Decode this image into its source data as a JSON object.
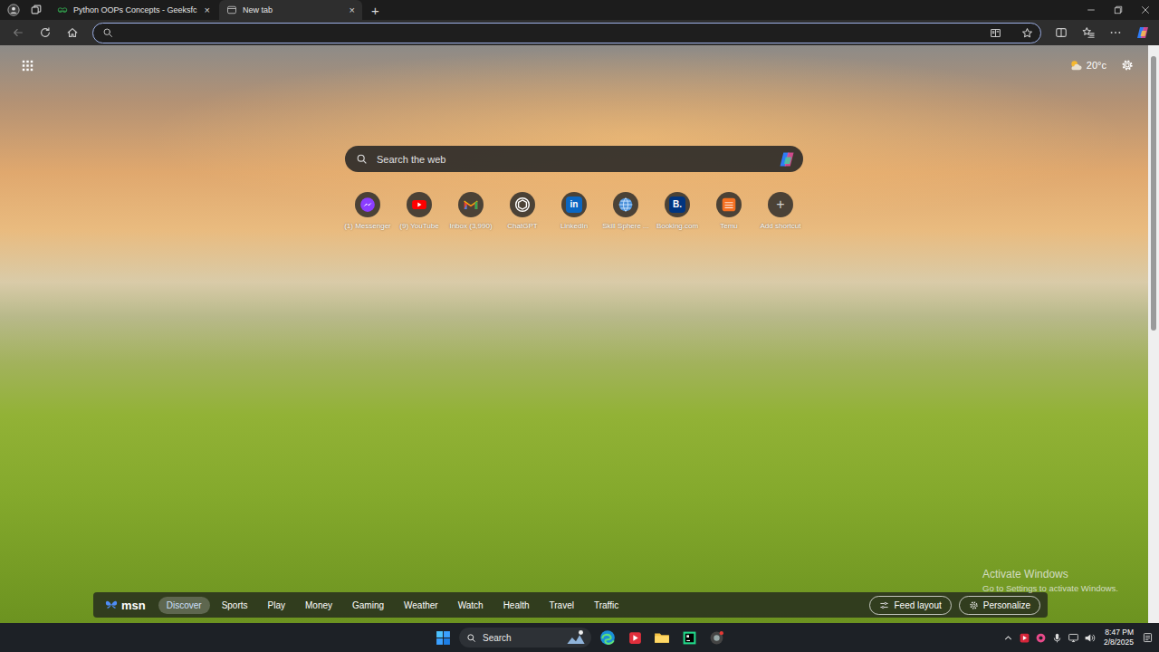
{
  "browser": {
    "tabs": [
      {
        "label": "Python OOPs Concepts - Geeksfc",
        "selected": false,
        "close": "×"
      },
      {
        "label": "New tab",
        "selected": true,
        "close": "×"
      }
    ],
    "new_tab": "+"
  },
  "page": {
    "weather": {
      "temp": "20°c"
    },
    "search": {
      "placeholder": "Search the web"
    },
    "shortcuts": [
      {
        "label": "(1) Messenger",
        "kind": "messenger",
        "color": "#8b3dff"
      },
      {
        "label": "(9) YouTube",
        "kind": "youtube",
        "color": "#ff0000"
      },
      {
        "label": "Inbox (3,990)",
        "kind": "gmail",
        "color": "#ea4335"
      },
      {
        "label": "ChatGPT",
        "kind": "chatgpt",
        "color": "#ffffff"
      },
      {
        "label": "LinkedIn",
        "kind": "linkedin",
        "color": "#0a66c2",
        "glyph": "in"
      },
      {
        "label": "Skill Sphere ...",
        "kind": "globe",
        "color": "#4a90d9"
      },
      {
        "label": "Booking.com",
        "kind": "booking",
        "color": "#003580",
        "glyph": "B."
      },
      {
        "label": "Temu",
        "kind": "temu",
        "color": "#f46f20"
      },
      {
        "label": "Add shortcut",
        "kind": "add",
        "color": "#d0d0d0",
        "glyph": "+"
      }
    ],
    "msn": {
      "logo": "msn",
      "tabs": [
        {
          "label": "Discover",
          "selected": true
        },
        {
          "label": "Sports",
          "selected": false
        },
        {
          "label": "Play",
          "selected": false
        },
        {
          "label": "Money",
          "selected": false
        },
        {
          "label": "Gaming",
          "selected": false
        },
        {
          "label": "Weather",
          "selected": false
        },
        {
          "label": "Watch",
          "selected": false
        },
        {
          "label": "Health",
          "selected": false
        },
        {
          "label": "Travel",
          "selected": false
        },
        {
          "label": "Traffic",
          "selected": false
        }
      ],
      "actions": [
        "Feed layout",
        "Personalize"
      ]
    },
    "watermark": {
      "title": "Activate Windows",
      "subtitle": "Go to Settings to activate Windows."
    }
  },
  "taskbar": {
    "search": "Search",
    "time": "8:47 PM",
    "date": "2/8/2025"
  }
}
